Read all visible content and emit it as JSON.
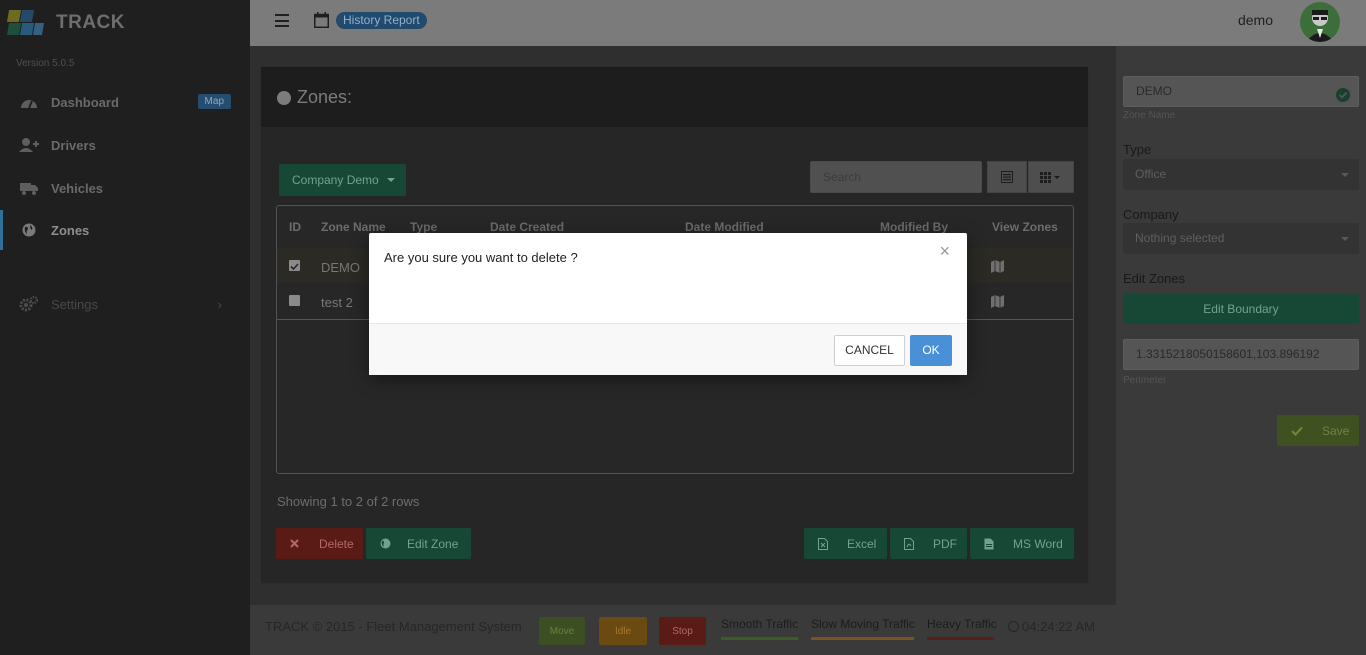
{
  "app": {
    "name": "TRACK",
    "version": "Version 5.0.5"
  },
  "sidebar": {
    "items": [
      {
        "label": "Dashboard",
        "icon": "dashboard-icon",
        "badge": "Map"
      },
      {
        "label": "Drivers",
        "icon": "user-plus-icon"
      },
      {
        "label": "Vehicles",
        "icon": "truck-icon"
      },
      {
        "label": "Zones",
        "icon": "globe-icon",
        "active": true
      },
      {
        "label": "Settings",
        "icon": "gears-icon",
        "chevron": "›"
      }
    ]
  },
  "topbar": {
    "history_label": "History Report",
    "user": "demo"
  },
  "main": {
    "title": "Zones:",
    "company_button": "Company Demo",
    "search_placeholder": "Search",
    "table": {
      "columns": [
        "ID",
        "Zone Name",
        "Type",
        "Date Created",
        "Date Modified",
        "Modified By",
        "View Zones"
      ],
      "rows": [
        {
          "checked": true,
          "name": "DEMO"
        },
        {
          "checked": false,
          "name": "test 2"
        }
      ]
    },
    "showing": "Showing 1 to 2 of 2 rows",
    "buttons": {
      "delete": "Delete",
      "edit_zone": "Edit Zone",
      "excel": "Excel",
      "pdf": "PDF",
      "msword": "MS Word"
    }
  },
  "right_panel": {
    "zone_name_value": "DEMO",
    "zone_name_help": "Zone Name",
    "type_label": "Type",
    "type_value": "Office",
    "company_label": "Company",
    "company_value": "Nothing selected",
    "edit_zones_label": "Edit Zones",
    "edit_boundary": "Edit Boundary",
    "perimeter_value": "1.3315218050158601,103.896192",
    "perimeter_help": "Perimeter",
    "save": "Save"
  },
  "footer": {
    "copyright": "TRACK © 2015 - Fleet Management System",
    "legend": {
      "move": "Move",
      "idle": "Idle",
      "stop": "Stop"
    },
    "traffic": {
      "smooth": "Smooth Traffic",
      "slow": "Slow Moving Traffic",
      "heavy": "Heavy Traffic"
    },
    "time": "04:24:22 AM"
  },
  "modal": {
    "message": "Are you sure you want to delete ?",
    "close": "×",
    "cancel": "CANCEL",
    "ok": "OK"
  },
  "colors": {
    "accent_green": "#174836",
    "danger_red": "#5a1b17",
    "primary_blue": "#4a90d6"
  }
}
